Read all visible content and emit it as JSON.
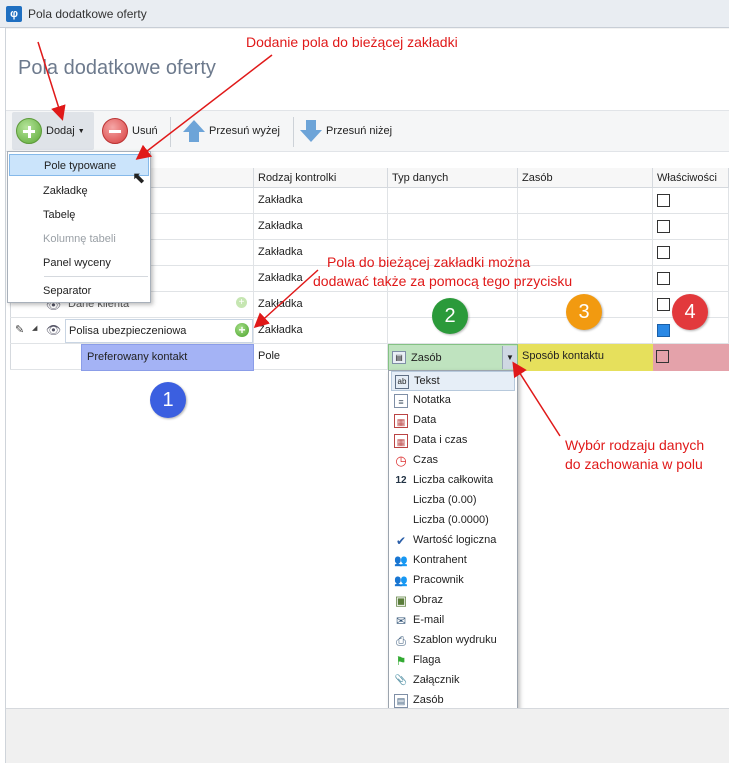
{
  "window": {
    "title": "Pola dodatkowe oferty",
    "app_icon": "φ"
  },
  "page_title": "Pola dodatkowe oferty",
  "toolbar": {
    "add_label": "Dodaj",
    "delete_label": "Usuń",
    "move_up_label": "Przesuń wyżej",
    "move_down_label": "Przesuń niżej"
  },
  "add_menu": {
    "items": [
      {
        "label": "Pole typowane",
        "selected": true
      },
      {
        "label": "Zakładkę"
      },
      {
        "label": "Tabelę"
      },
      {
        "label": "Kolumnę tabeli",
        "disabled": true
      },
      {
        "label": "Panel wyceny"
      },
      {
        "label": "Separator"
      }
    ]
  },
  "grid": {
    "columns": [
      "Rodzaj kontrolki",
      "Typ danych",
      "Zasób",
      "Właściwości"
    ],
    "rows": [
      {
        "name": "",
        "kind": "Zakładka",
        "type": "",
        "resource": ""
      },
      {
        "name": "",
        "kind": "Zakładka",
        "type": "",
        "resource": ""
      },
      {
        "name": "",
        "kind": "Zakładka",
        "type": "",
        "resource": ""
      },
      {
        "name": "",
        "kind": "Zakładka",
        "type": "",
        "resource": ""
      },
      {
        "name": "Dane klienta",
        "kind": "Zakładka",
        "type": "",
        "resource": ""
      },
      {
        "name": "Polisa ubezpieczeniowa",
        "kind": "Zakładka",
        "type": "",
        "resource": ""
      },
      {
        "name": "Preferowany kontakt",
        "kind": "Pole",
        "type": "Zasób",
        "resource": "Sposób kontaktu"
      }
    ]
  },
  "type_list": {
    "items": [
      {
        "label": "Tekst",
        "icon": "text-icon",
        "glyph": "ab"
      },
      {
        "label": "Notatka",
        "icon": "note-icon",
        "glyph": "≡"
      },
      {
        "label": "Data",
        "icon": "calendar-icon",
        "glyph": "▦"
      },
      {
        "label": "Data i czas",
        "icon": "datetime-icon",
        "glyph": "▦"
      },
      {
        "label": "Czas",
        "icon": "clock-icon",
        "glyph": "◷"
      },
      {
        "label": "Liczba całkowita",
        "icon": "integer-icon",
        "glyph": "12"
      },
      {
        "label": "Liczba (0.00)",
        "icon": "",
        "glyph": ""
      },
      {
        "label": "Liczba (0.0000)",
        "icon": "",
        "glyph": ""
      },
      {
        "label": "Wartość logiczna",
        "icon": "checkmark-icon",
        "glyph": "✔"
      },
      {
        "label": "Kontrahent",
        "icon": "contractor-icon",
        "glyph": "👥"
      },
      {
        "label": "Pracownik",
        "icon": "employee-icon",
        "glyph": "👥"
      },
      {
        "label": "Obraz",
        "icon": "image-icon",
        "glyph": "▣"
      },
      {
        "label": "E-mail",
        "icon": "email-icon",
        "glyph": "✉"
      },
      {
        "label": "Szablon wydruku",
        "icon": "printer-icon",
        "glyph": "⎙"
      },
      {
        "label": "Flaga",
        "icon": "flag-icon",
        "glyph": "⚑"
      },
      {
        "label": "Załącznik",
        "icon": "paperclip-icon",
        "glyph": "📎"
      },
      {
        "label": "Zasób",
        "icon": "resource-icon",
        "glyph": "▤"
      }
    ]
  },
  "annotations": {
    "add_field": "Dodanie pola do bieżącej zakładki",
    "add_via_button_1": "Pola do bieżącej zakładki można",
    "add_via_button_2": "dodawać także za pomocą tego przycisku",
    "choose_type_1": "Wybór rodzaju danych",
    "choose_type_2": "do zachowania w polu",
    "badges": [
      "1",
      "2",
      "3",
      "4"
    ]
  },
  "colors": {
    "annotation_red": "#e01919",
    "badge_blue": "#3b5fe0",
    "badge_green": "#2b9a3a",
    "badge_orange": "#f29a10",
    "badge_red": "#e2393c"
  }
}
